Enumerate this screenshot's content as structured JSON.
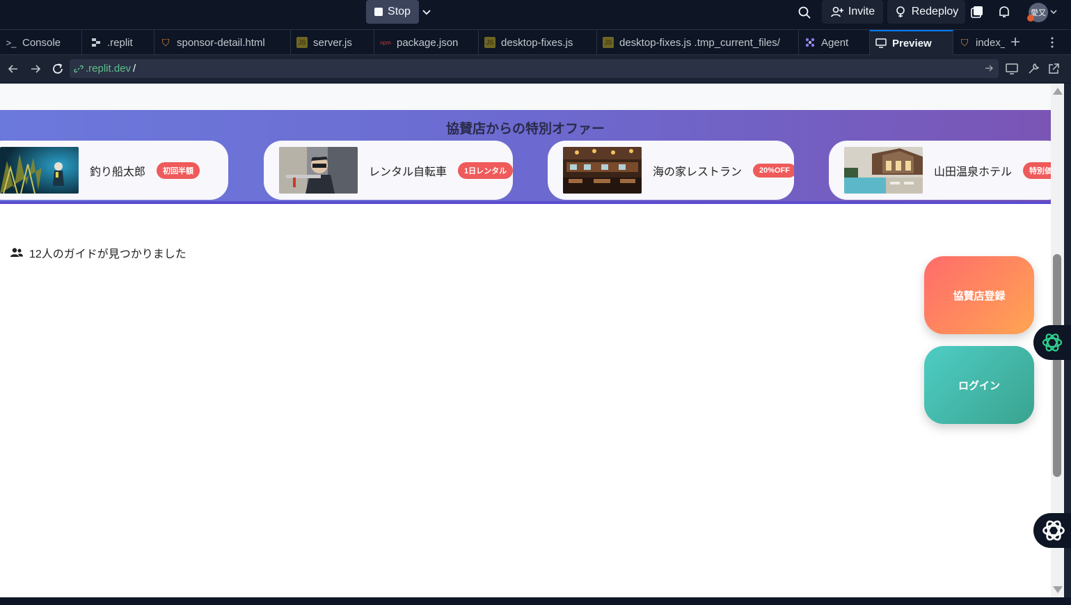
{
  "topbar": {
    "stop_label": "Stop",
    "invite_label": "Invite",
    "redeploy_label": "Redeploy",
    "avatar_text": "愛又"
  },
  "tabs": [
    {
      "label": "Console",
      "icon": "console-icon"
    },
    {
      "label": ".replit",
      "icon": "replit-config-icon"
    },
    {
      "label": "sponsor-detail.html",
      "icon": "html-file-icon"
    },
    {
      "label": "server.js",
      "icon": "js-file-icon"
    },
    {
      "label": "package.json",
      "icon": "json-file-icon"
    },
    {
      "label": "desktop-fixes.js",
      "icon": "js-file-icon"
    },
    {
      "label": "desktop-fixes.js .tmp_current_files/",
      "icon": "js-file-icon"
    },
    {
      "label": "Agent",
      "icon": "agent-icon"
    },
    {
      "label": "Preview",
      "icon": "monitor-icon",
      "active": true
    },
    {
      "label": "index_",
      "icon": "html-file-icon"
    }
  ],
  "urlbar": {
    "host": ".replit.dev",
    "path": "/"
  },
  "preview": {
    "banner_title": "協賛店からの特別オファー",
    "sponsors": [
      {
        "name": "釣り船太郎",
        "badge": "初回半額"
      },
      {
        "name": "レンタル自転車",
        "badge": "1日レンタル"
      },
      {
        "name": "海の家レストラン",
        "badge": "20%OFF"
      },
      {
        "name": "山田温泉ホテル",
        "badge": "特別価格"
      }
    ],
    "guide_count_text": "12人のガイドが見つかりました",
    "sponsor_register_label": "協賛店登録",
    "login_label": "ログイン"
  },
  "colors": {
    "accent": "#0079f2",
    "banner_start": "#6c79dc",
    "banner_end": "#7a55b5",
    "badge": "#ef5a5a",
    "sponsor_btn_start": "#ff6b6b",
    "sponsor_btn_end": "#ffa552",
    "login_btn_start": "#4ecdc4",
    "login_btn_end": "#3aa38f"
  }
}
